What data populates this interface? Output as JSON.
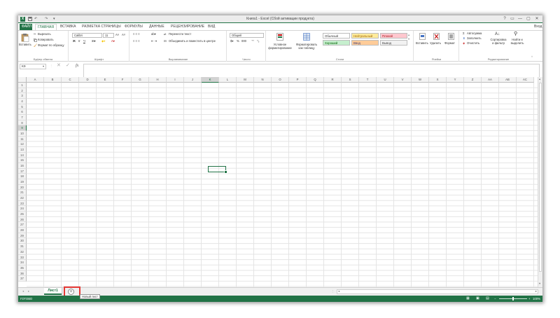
{
  "titlebar": {
    "logo": "X",
    "title": "Книга1 - Excel (Сбой активации продукта)",
    "window_controls": [
      "?",
      "▭",
      "—",
      "▢",
      "✕"
    ]
  },
  "tabs": [
    "ФАЙЛ",
    "ГЛАВНАЯ",
    "ВСТАВКА",
    "РАЗМЕТКА СТРАНИЦЫ",
    "ФОРМУЛЫ",
    "ДАННЫЕ",
    "РЕЦЕНЗИРОВАНИЕ",
    "ВИД"
  ],
  "signin": "Вход",
  "ribbon": {
    "clipboard": {
      "paste": "Вставить",
      "cut": "Вырезать",
      "copy": "Копировать",
      "format_painter": "Формат по образцу",
      "label": "Буфер обмена"
    },
    "font": {
      "name": "Calibri",
      "size": "11",
      "bold": "Ж",
      "italic": "К",
      "underline": "Ч",
      "label": "Шрифт"
    },
    "alignment": {
      "wrap": "Перенести текст",
      "merge": "Объединить и поместить в центре",
      "label": "Выравнивание"
    },
    "number": {
      "format": "Общий",
      "percent": "%",
      "thousands": "000",
      "label": "Число"
    },
    "styles": {
      "conditional": "Условное форматирование",
      "as_table": "Форматировать как таблицу",
      "cells": [
        {
          "text": "Обычный",
          "bg": "#ffffff",
          "fg": "#333333"
        },
        {
          "text": "Нейтральный",
          "bg": "#ffeb9c",
          "fg": "#9c6500"
        },
        {
          "text": "Плохой",
          "bg": "#ffc7ce",
          "fg": "#9c0006"
        },
        {
          "text": "Хороший",
          "bg": "#c6efce",
          "fg": "#006100"
        },
        {
          "text": "Ввод",
          "bg": "#ffcc99",
          "fg": "#3f3f76"
        },
        {
          "text": "Вывод",
          "bg": "#f2f2f2",
          "fg": "#3f3f3f"
        }
      ],
      "label": "Стили"
    },
    "cells": {
      "insert": "Вставить",
      "delete": "Удалить",
      "format": "Формат",
      "label": "Ячейки"
    },
    "editing": {
      "autosum": "Автосумма",
      "fill": "Заполнить",
      "clear": "Очистить",
      "sort": "Сортировка и фильтр",
      "find": "Найти и выделить",
      "label": "Редактирование"
    }
  },
  "formula_bar": {
    "name_box": "K9",
    "fx": "fx",
    "value": ""
  },
  "grid": {
    "columns": [
      "A",
      "B",
      "C",
      "D",
      "E",
      "F",
      "G",
      "H",
      "I",
      "J",
      "K",
      "L",
      "M",
      "N",
      "O",
      "P",
      "Q",
      "R",
      "S",
      "T",
      "U",
      "V",
      "W",
      "X",
      "Y",
      "Z",
      "AA",
      "AB",
      "AC"
    ],
    "rows": [
      "1",
      "2",
      "3",
      "4",
      "5",
      "6",
      "7",
      "8",
      "9",
      "10",
      "11",
      "12",
      "13",
      "14",
      "15",
      "16",
      "17",
      "18",
      "19",
      "20",
      "21",
      "22",
      "23",
      "24",
      "25",
      "26",
      "27",
      "28",
      "29",
      "30",
      "31",
      "32",
      "33",
      "34",
      "35",
      "36",
      "37"
    ],
    "selected_column": "K",
    "selected_row": "9"
  },
  "sheets": {
    "tabs": [
      "Лист1"
    ],
    "add_tooltip": "Новый лист"
  },
  "status": {
    "left": "ГОТОВО",
    "zoom": "100%"
  },
  "colors": {
    "accent": "#217346"
  }
}
